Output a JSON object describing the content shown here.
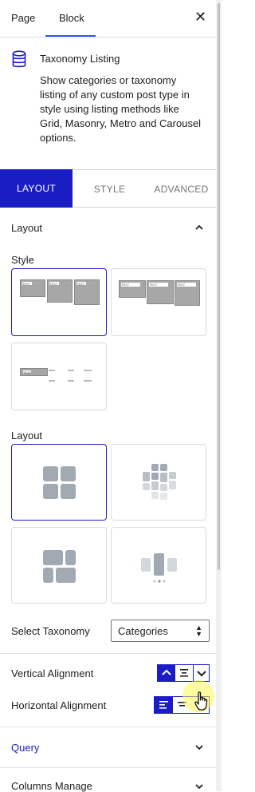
{
  "header": {
    "tabs": [
      "Page",
      "Block"
    ],
    "active_tab": "Block"
  },
  "block": {
    "title": "Taxonomy Listing",
    "description": "Show categories or taxonomy listing of any custom post type in style using listing methods like Grid, Masonry, Metro and Carousel options."
  },
  "settings_tabs": [
    "LAYOUT",
    "STYLE",
    "ADVANCED"
  ],
  "layout_panel": {
    "title": "Layout",
    "style_label": "Style",
    "layout_label": "Layout",
    "thumb_text": "TEXT",
    "select_taxonomy_label": "Select Taxonomy",
    "select_taxonomy_value": "Categories",
    "vertical_alignment_label": "Vertical Alignment",
    "horizontal_alignment_label": "Horizontal Alignment"
  },
  "collapsed_panels": [
    "Query",
    "Columns Manage"
  ],
  "colors": {
    "accent": "#1b1dc4",
    "link": "#3858e9",
    "tile": "#a1aab3"
  }
}
